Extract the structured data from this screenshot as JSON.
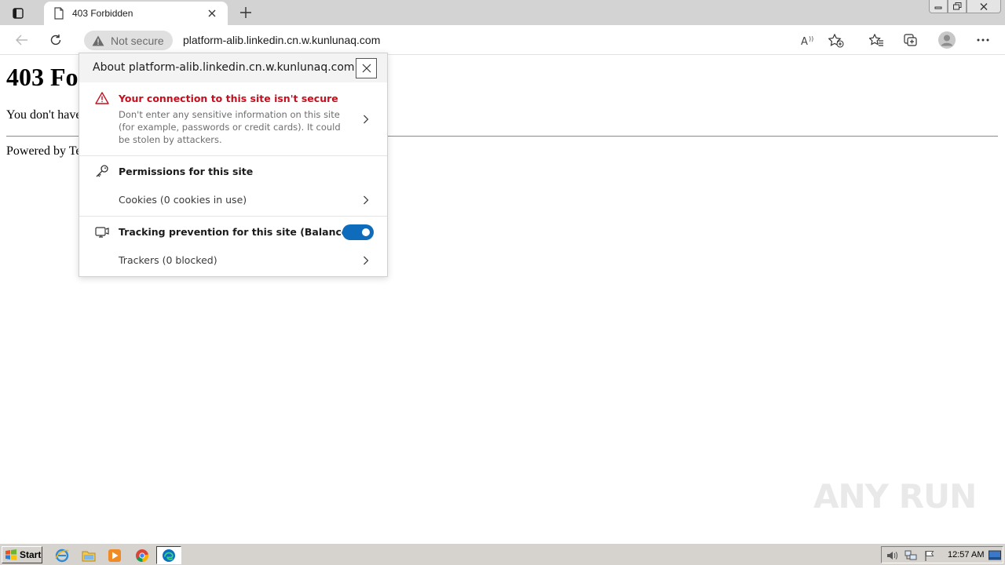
{
  "browser": {
    "tab": {
      "title": "403 Forbidden",
      "favicon_icon": "page-icon",
      "close_icon": "close-icon"
    },
    "new_tab_icon": "plus-icon",
    "address_bar": {
      "security_label": "Not secure",
      "security_icon": "warning-triangle-icon",
      "url": "platform-alib.linkedin.cn.w.kunlunaq.com"
    },
    "toolbar_icons": [
      "back-icon",
      "refresh-icon",
      "read-aloud-icon",
      "add-favorite-icon",
      "favorites-icon",
      "collections-icon",
      "profile-icon",
      "more-icon"
    ]
  },
  "page": {
    "heading": "403 Fo",
    "message": "You don't have",
    "footer": "Powered by Te"
  },
  "site_info": {
    "title": "About platform-alib.linkedin.cn.w.kunlunaq.com",
    "warning_title": "Your connection to this site isn't secure",
    "warning_desc": "Don't enter any sensitive information on this site (for example, passwords or credit cards). It could be stolen by attackers.",
    "permissions_title": "Permissions for this site",
    "cookies_label": "Cookies (0 cookies in use)",
    "tracking_title": "Tracking prevention for this site (Balanced)",
    "tracking_enabled": true,
    "trackers_label": "Trackers (0 blocked)"
  },
  "watermark": "ANY RUN",
  "taskbar": {
    "start_label": "Start",
    "clock": "12:57 AM",
    "pinned": [
      "ie-icon",
      "explorer-icon",
      "media-player-icon",
      "chrome-icon",
      "edge-icon"
    ]
  },
  "colors": {
    "accent": "#0f6cbd",
    "danger": "#c50f1f",
    "tabstrip": "#d3d3d3",
    "taskbar": "#d6d3ce"
  }
}
